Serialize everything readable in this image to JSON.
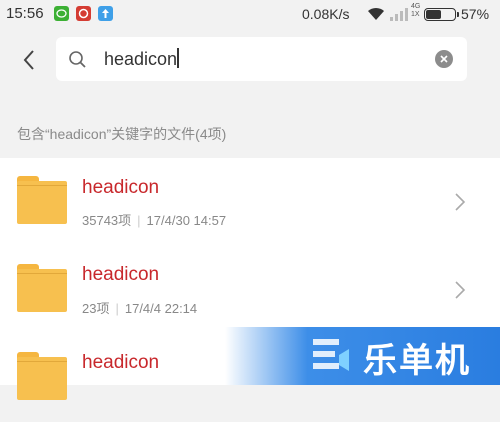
{
  "status_bar": {
    "time": "15:56",
    "net_speed": "0.08K/s",
    "signal_text": "4G\n1X",
    "battery_level_percent": 57,
    "battery_label": "57%"
  },
  "search": {
    "query": "headicon"
  },
  "results": {
    "header": "包含“headicon”关键字的文件(4项)",
    "items": [
      {
        "name": "headicon",
        "count": "35743项",
        "date": "17/4/30 14:57"
      },
      {
        "name": "headicon",
        "count": "23项",
        "date": "17/4/4 22:14"
      },
      {
        "name": "headicon"
      }
    ]
  },
  "watermark": {
    "text": "乐单机"
  },
  "colors": {
    "accent": "#c8282c",
    "folder": "#f7c04f",
    "watermark_blue": "#2a7de0"
  }
}
